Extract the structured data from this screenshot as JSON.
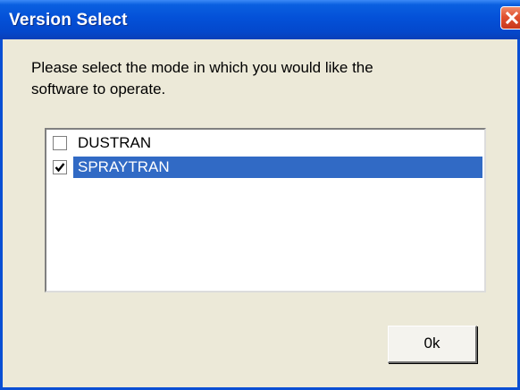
{
  "window": {
    "title": "Version Select",
    "close_icon": "close-icon",
    "title_bar_color": "#0451d8",
    "close_color": "#e0502e"
  },
  "prompt": {
    "line1": "Please select the mode in which you would like the",
    "line2": "software to operate."
  },
  "mode_list": {
    "items": [
      {
        "label": "DUSTRAN",
        "checked": false,
        "selected": false
      },
      {
        "label": "SPRAYTRAN",
        "checked": true,
        "selected": true
      }
    ],
    "selection_color": "#316ac5"
  },
  "buttons": {
    "ok_label": "0k"
  }
}
